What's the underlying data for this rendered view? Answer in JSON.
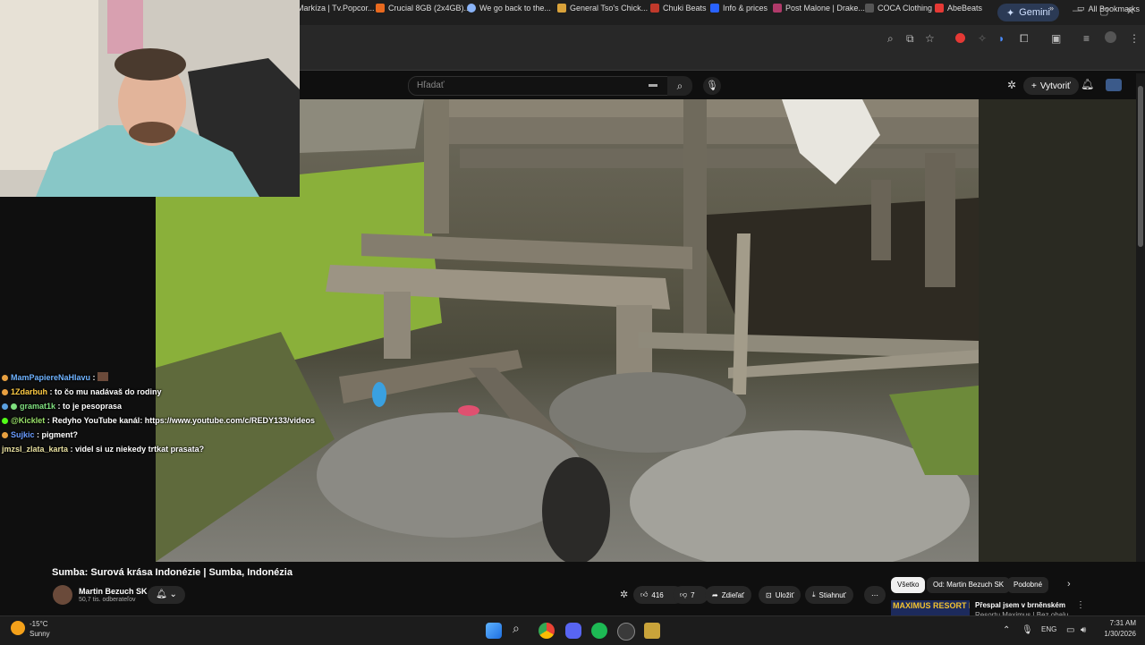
{
  "browser": {
    "gemini_label": "Gemini",
    "bookmarks": [
      {
        "label": "Markíza | Tv.Popcor...",
        "color": "#c74b4b"
      },
      {
        "label": "Crucial 8GB (2x4GB)...",
        "color": "#e96a1f"
      },
      {
        "label": "We go back to the...",
        "color": "#8ab4f8"
      },
      {
        "label": "General Tso's Chick...",
        "color": "#d9a23a"
      },
      {
        "label": "Chuki Beats",
        "color": "#c0392b"
      },
      {
        "label": "Info & prices",
        "color": "#2962ff"
      },
      {
        "label": "Post Malone | Drake...",
        "color": "#b03a6a"
      },
      {
        "label": "COCA Clothing",
        "color": "#555555"
      },
      {
        "label": "AbeBeats",
        "color": "#e53935"
      }
    ],
    "all_bookmarks": "All Bookmarks"
  },
  "youtube": {
    "search_placeholder": "Hľadať",
    "create_label": "Vytvoriť"
  },
  "chat": [
    {
      "user": "MamPapiereNaHlavu",
      "message": "",
      "user_color": "#6fb3ff",
      "dot_color": "#e8a040"
    },
    {
      "user": "1Zdarbuh",
      "message": "to čo mu nadávaš do rodiny",
      "user_color": "#ffcc44",
      "dot_color": "#e8a040"
    },
    {
      "user": "gramat1k",
      "message": "to je pesoprasa",
      "user_color": "#7fe07f",
      "dot_color": "#5aa0e0"
    },
    {
      "user": "@Kicklet",
      "message": "Redyho YouTube kanál: https://www.youtube.com/c/REDY133/videos",
      "user_color": "#9be36a",
      "dot_color": "#53fc18"
    },
    {
      "user": "Sujkic",
      "message": "pigment?",
      "user_color": "#6a9cff",
      "dot_color": "#e8a040"
    },
    {
      "user": "jmzsl_zlata_karta",
      "message": "videl si uz niekedy trtkat prasata?",
      "user_color": "#e8e0a0",
      "dot_color": ""
    }
  ],
  "video": {
    "title": "Sumba: Surová krása Indonézie | Sumba, Indonézia",
    "channel": "Martin Bezuch SK",
    "subscribers": "50,7 tis. odberateľov",
    "likes": "416",
    "dislikes": "7",
    "share_label": "Zdieľať",
    "save_label": "Uložiť",
    "download_label": "Stiahnuť"
  },
  "chips": [
    "Všetko",
    "Od: Martin Bezuch SK",
    "Podobné"
  ],
  "recommendation": {
    "title": "Přespal jsem v brněnském",
    "subtitle": "Resortu Maximus | Bez obalu",
    "thumb_text": "MAXIMUS RESORT BRNO"
  },
  "taskbar": {
    "temperature": "-15°C",
    "weather": "Sunny",
    "language": "ENG",
    "time": "7:31 AM",
    "date": "1/30/2026"
  }
}
